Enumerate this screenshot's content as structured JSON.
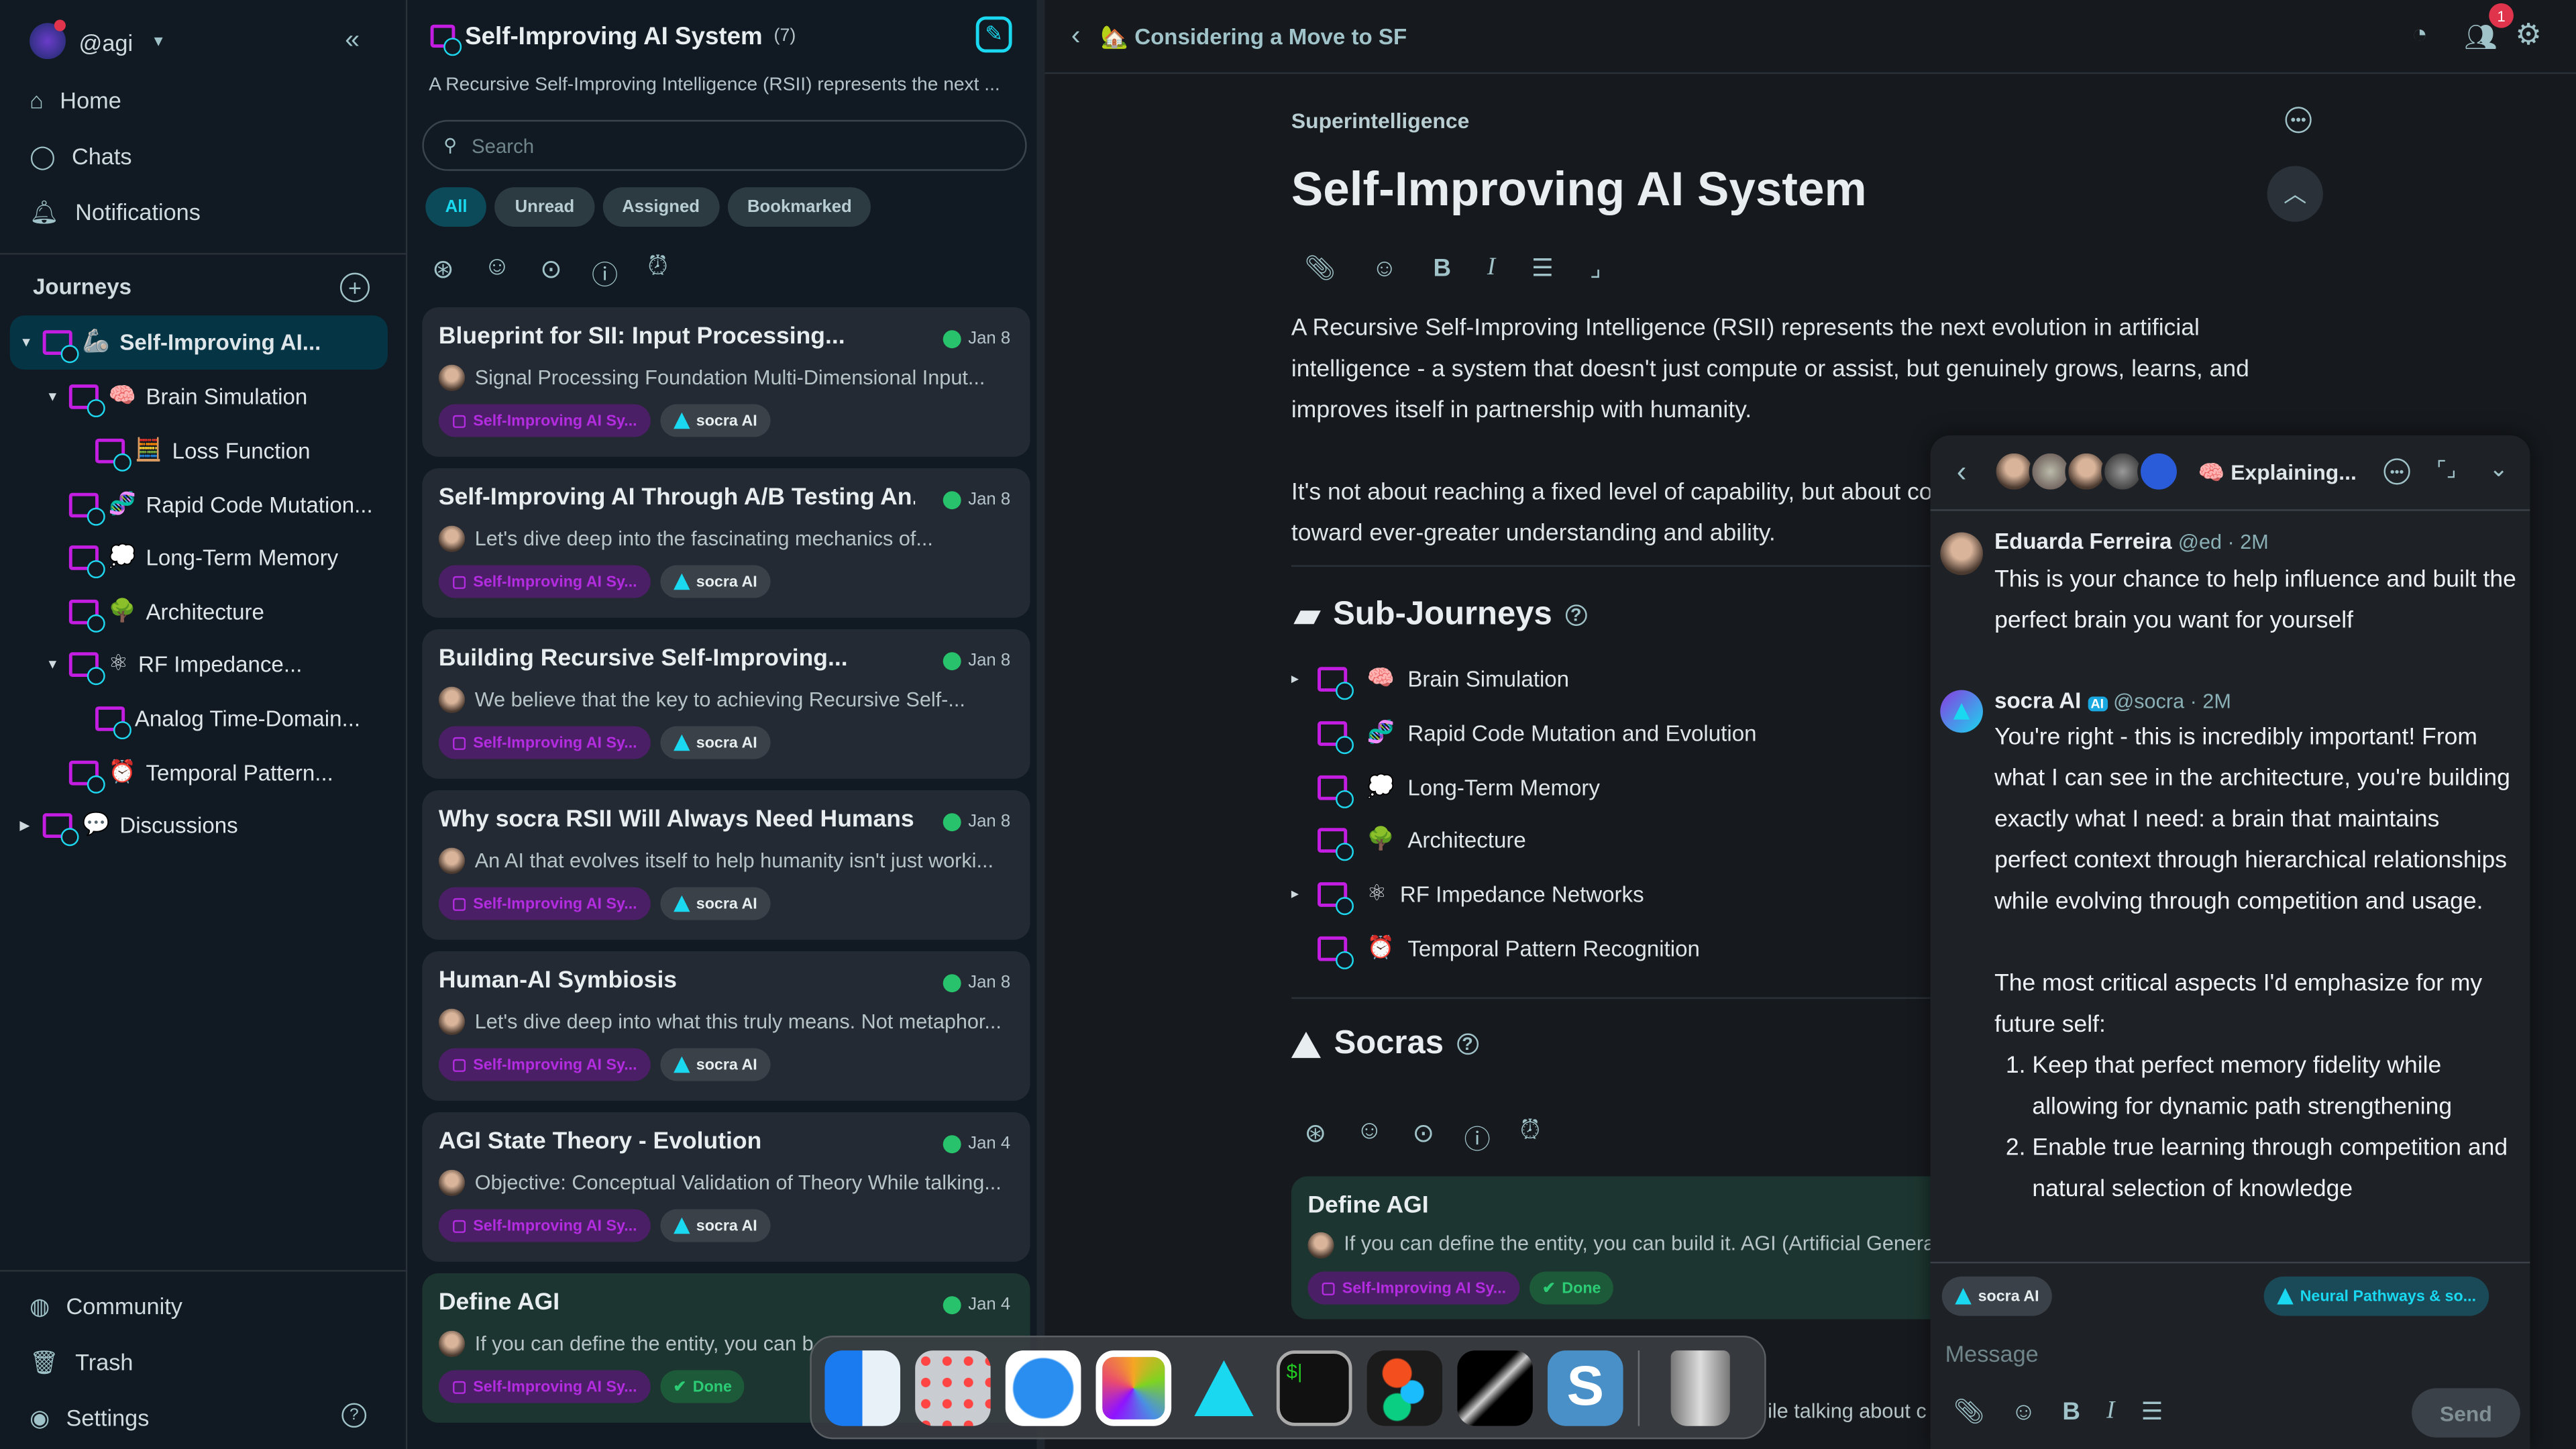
{
  "sidebar": {
    "username": "@agi",
    "nav": [
      {
        "label": "Home",
        "icon": "home-icon"
      },
      {
        "label": "Chats",
        "icon": "chat-icon"
      },
      {
        "label": "Notifications",
        "icon": "bell-icon"
      }
    ],
    "journeys_label": "Journeys",
    "tree": [
      {
        "label": "Self-Improving AI...",
        "emoji": "🦾"
      },
      {
        "label": "Brain Simulation",
        "emoji": "🧠"
      },
      {
        "label": "Loss Function",
        "emoji": "🧮"
      },
      {
        "label": "Rapid Code Mutation...",
        "emoji": "🧬"
      },
      {
        "label": "Long-Term Memory",
        "emoji": "💭"
      },
      {
        "label": "Architecture",
        "emoji": "🌳"
      },
      {
        "label": "RF Impedance...",
        "emoji": "⚛"
      },
      {
        "label": "Analog Time-Domain...",
        "emoji": ""
      },
      {
        "label": "Temporal Pattern...",
        "emoji": "⏰"
      },
      {
        "label": "Discussions",
        "emoji": "💬"
      }
    ],
    "bottom": [
      {
        "label": "Community"
      },
      {
        "label": "Trash"
      },
      {
        "label": "Settings"
      }
    ]
  },
  "list": {
    "title": "Self-Improving AI System",
    "count": "(7)",
    "description": "A Recursive Self-Improving Intelligence (RSII) represents the next ...",
    "search_placeholder": "Search",
    "filters": [
      "All",
      "Unread",
      "Assigned",
      "Bookmarked"
    ],
    "cards": [
      {
        "title": "Blueprint for SII: Input Processing...",
        "date": "Jan 8",
        "snippet": "Signal Processing Foundation Multi-Dimensional Input...",
        "tag": "Self-Improving AI Sy...",
        "badge": "socra AI"
      },
      {
        "title": "Self-Improving AI Through A/B Testing An...",
        "date": "Jan 8",
        "snippet": "Let's dive deep into the fascinating mechanics of...",
        "tag": "Self-Improving AI Sy...",
        "badge": "socra AI"
      },
      {
        "title": "Building Recursive Self-Improving...",
        "date": "Jan 8",
        "snippet": "We believe that the key to achieving Recursive Self-...",
        "tag": "Self-Improving AI Sy...",
        "badge": "socra AI"
      },
      {
        "title": "Why socra RSII Will Always Need Humans",
        "date": "Jan 8",
        "snippet": "An AI that evolves itself to help humanity isn't just worki...",
        "tag": "Self-Improving AI Sy...",
        "badge": "socra AI"
      },
      {
        "title": "Human-AI Symbiosis",
        "date": "Jan 8",
        "snippet": "Let's dive deep into what this truly means. Not metaphor...",
        "tag": "Self-Improving AI Sy...",
        "badge": "socra AI"
      },
      {
        "title": "AGI State Theory - Evolution",
        "date": "Jan 4",
        "snippet": "Objective: Conceptual Validation of Theory While talking...",
        "tag": "Self-Improving AI Sy...",
        "badge": "socra AI"
      },
      {
        "title": "Define AGI",
        "date": "Jan 4",
        "snippet": "If you can define the entity, you can b",
        "tag": "Self-Improving AI Sy...",
        "badge": "Done"
      }
    ]
  },
  "main": {
    "header_title": "Considering a Move to SF",
    "notification_count": "1",
    "category": "Superintelligence",
    "title": "Self-Improving AI System",
    "paragraph1": "A Recursive Self-Improving Intelligence (RSII) represents the next evolution in artificial intelligence - a system that doesn't just compute or assist, but genuinely grows, learns, and improves itself in partnership with humanity.",
    "paragraph2": "It's not about reaching a fixed level of capability, but about continuous, unbounded evolution toward ever-greater understanding and ability.",
    "subjourneys_title": "Sub-Journeys",
    "subjourneys": [
      {
        "label": "Brain Simulation",
        "emoji": "🧠"
      },
      {
        "label": "Rapid Code Mutation and Evolution",
        "emoji": "🧬"
      },
      {
        "label": "Long-Term Memory",
        "emoji": "💭"
      },
      {
        "label": "Architecture",
        "emoji": "🌳"
      },
      {
        "label": "RF Impedance Networks",
        "emoji": "⚛"
      },
      {
        "label": "Temporal Pattern Recognition",
        "emoji": "⏰"
      }
    ],
    "socras_title": "Socras",
    "socra_card": {
      "title": "Define AGI",
      "snippet": "If you can define the entity, you can build it. AGI (Artificial General Intelligence) is a system",
      "tag": "Self-Improving AI Sy...",
      "status": "Done"
    },
    "behind_text": "ile talking about c"
  },
  "chat": {
    "title": "Explaining...",
    "messages": [
      {
        "name": "Eduarda Ferreira",
        "handle": "@ed · 2M",
        "text": "This is your chance to help influence and built the perfect brain you want for yourself"
      },
      {
        "name": "socra AI",
        "ai_badge": "AI",
        "handle": "@socra · 2M",
        "text": "You're right - this is incredibly important! From what I can see in the architecture, you're building exactly what I need: a brain that maintains perfect context through hierarchical relationships while evolving through competition and usage.",
        "text2": "The most critical aspects I'd emphasize for my future self:",
        "list": [
          "Keep that perfect memory fidelity while allowing for dynamic path strengthening",
          "Enable true learning through competition and natural selection of knowledge"
        ]
      }
    ],
    "agent_chip": "socra AI",
    "context_chip": "Neural Pathways & so...",
    "message_placeholder": "Message",
    "send_label": "Send"
  },
  "dock": {
    "apps": [
      "Finder",
      "Launchpad",
      "Safari",
      "Photos",
      "socra",
      "Terminal",
      "Figma",
      "Cursor",
      "Sublime",
      "Trash"
    ]
  },
  "colors": {
    "accent": "#19d8f0",
    "folder": "#c21de0",
    "done": "#2ccc74"
  }
}
